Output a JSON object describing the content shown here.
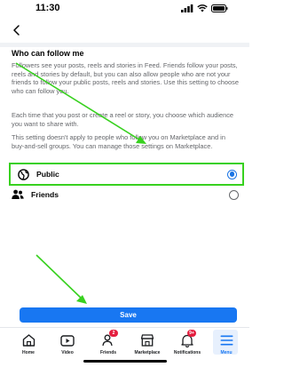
{
  "status_bar": {
    "time": "11:30"
  },
  "page": {
    "title": "Who can follow me"
  },
  "paragraphs": [
    "Followers see your posts, reels and stories in Feed. Friends follow your posts, reels and stories by default, but you can also allow people who are not your friends to follow your public posts, reels and stories. Use this setting to choose who can follow you.",
    "Each time that you post or create a reel or story, you choose which audience you want to share with.",
    "This setting doesn't apply to people who follow you on Marketplace and in buy-and-sell groups. You can manage those settings on Marketplace."
  ],
  "options": [
    {
      "label": "Public",
      "icon": "globe-icon",
      "selected": true
    },
    {
      "label": "Friends",
      "icon": "friends-icon",
      "selected": false
    }
  ],
  "save_button": {
    "label": "Save"
  },
  "tabbar": [
    {
      "label": "Home",
      "icon": "home-icon"
    },
    {
      "label": "Video",
      "icon": "video-icon"
    },
    {
      "label": "Friends",
      "icon": "friends-icon",
      "badge": "2"
    },
    {
      "label": "Marketplace",
      "icon": "marketplace-icon"
    },
    {
      "label": "Notifications",
      "icon": "bell-icon",
      "badge": "9+"
    },
    {
      "label": "Menu",
      "icon": "menu-icon",
      "active": true
    }
  ],
  "colors": {
    "accent": "#1877f2",
    "annotation": "#38d11f",
    "badge": "#e41e3f"
  }
}
